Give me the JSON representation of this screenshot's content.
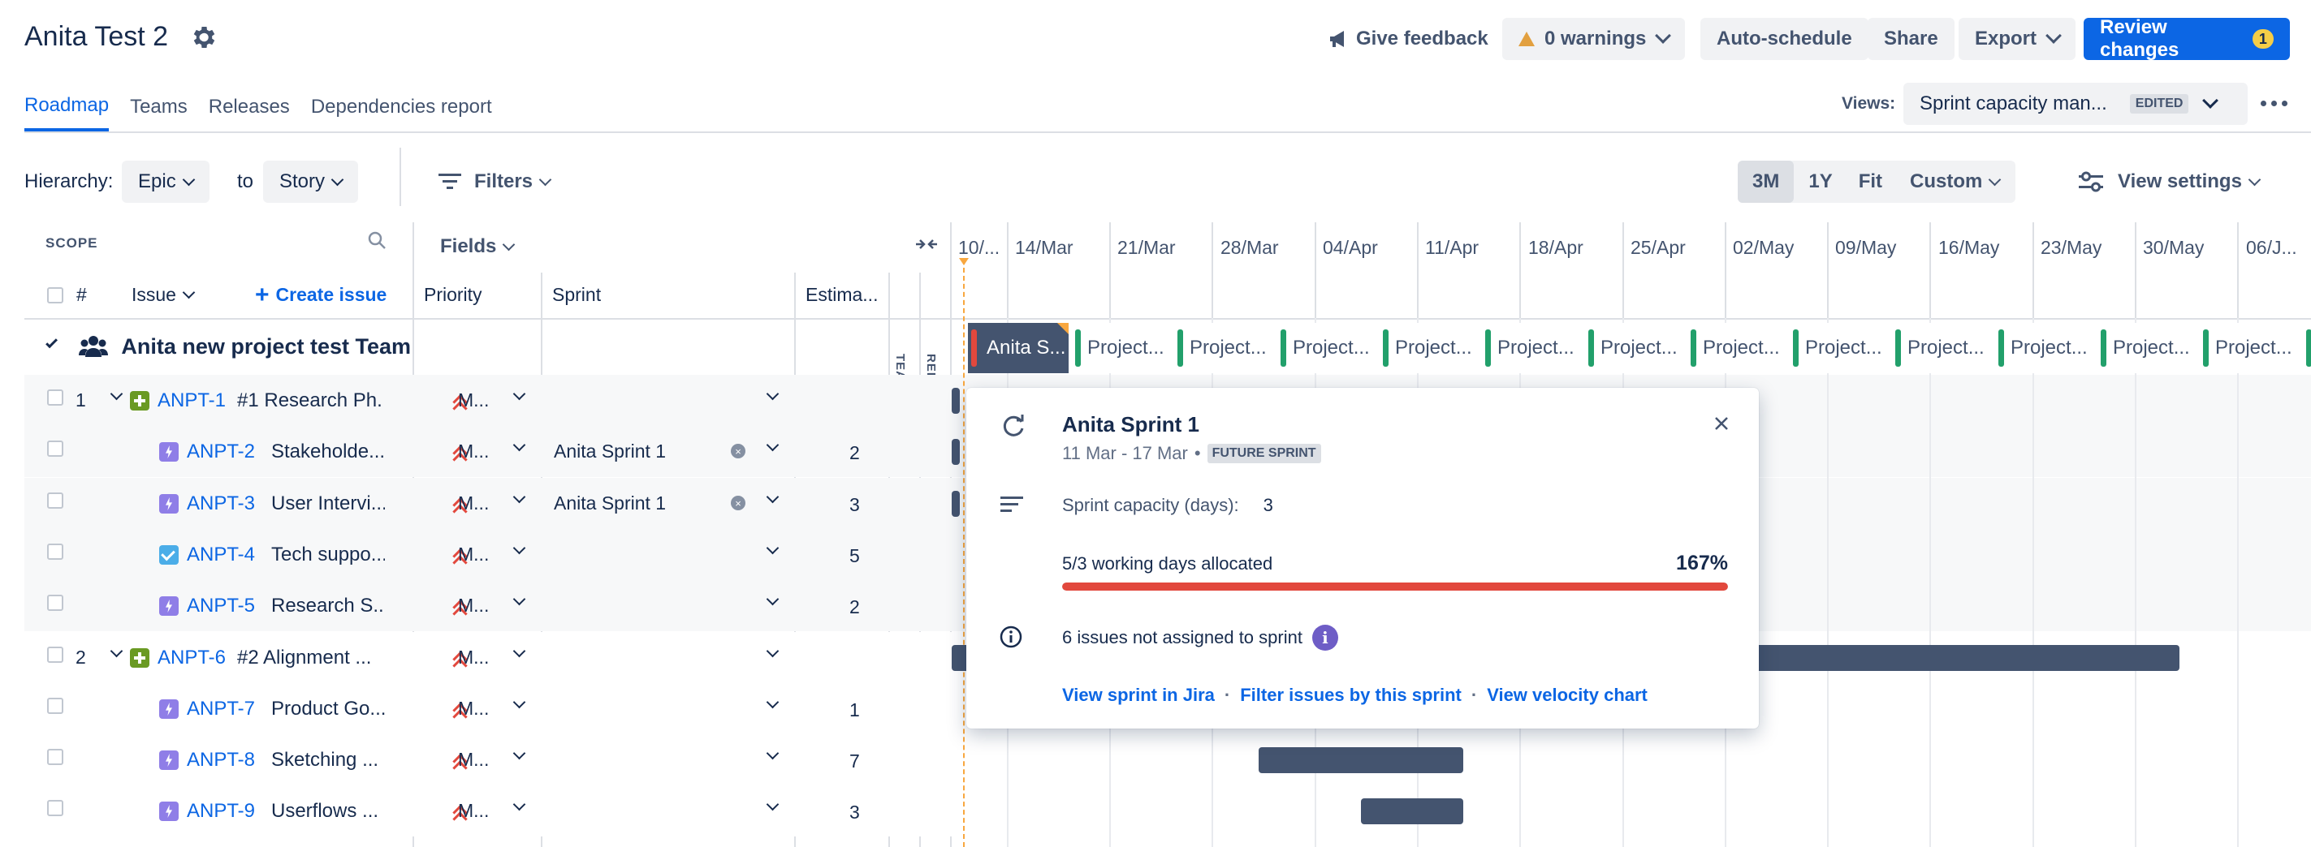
{
  "header": {
    "title": "Anita Test 2",
    "give_feedback": "Give feedback",
    "warnings": "0 warnings",
    "auto_schedule": "Auto-schedule",
    "share": "Share",
    "export": "Export",
    "review_changes": "Review changes",
    "review_count": "1"
  },
  "tabs": [
    "Roadmap",
    "Teams",
    "Releases",
    "Dependencies report"
  ],
  "views": {
    "label": "Views:",
    "value": "Sprint capacity man...",
    "badge": "EDITED"
  },
  "toolbar": {
    "hierarchy_label": "Hierarchy:",
    "hierarchy_from": "Epic",
    "to_label": "to",
    "hierarchy_to": "Story",
    "filters": "Filters",
    "zoom": [
      "3M",
      "1Y",
      "Fit",
      "Custom"
    ],
    "view_settings": "View settings"
  },
  "scope": {
    "label": "SCOPE",
    "fields": "Fields",
    "col_hash": "#",
    "col_issue": "Issue",
    "create_issue": "Create issue",
    "col_priority": "Priority",
    "col_sprint": "Sprint",
    "col_estimate": "Estima...",
    "team_vertical": "TEAM",
    "release_vertical": "RELEASE"
  },
  "group": {
    "name": "Anita new project test Team"
  },
  "rows": [
    {
      "num": "1",
      "type": "epic",
      "key": "ANPT-1",
      "summary": "#1 Research Ph...",
      "priority": "M...",
      "sprint": "",
      "estimate": ""
    },
    {
      "num": "",
      "type": "story",
      "key": "ANPT-2",
      "summary": "Stakeholde...",
      "priority": "M...",
      "sprint": "Anita Sprint 1",
      "estimate": "2"
    },
    {
      "num": "",
      "type": "story",
      "key": "ANPT-3",
      "summary": "User Intervi...",
      "priority": "M...",
      "sprint": "Anita Sprint 1",
      "estimate": "3"
    },
    {
      "num": "",
      "type": "task",
      "key": "ANPT-4",
      "summary": "Tech suppo...",
      "priority": "M...",
      "sprint": "",
      "estimate": "5"
    },
    {
      "num": "",
      "type": "story",
      "key": "ANPT-5",
      "summary": "Research S...",
      "priority": "M...",
      "sprint": "",
      "estimate": "2"
    },
    {
      "num": "2",
      "type": "epic",
      "key": "ANPT-6",
      "summary": "#2 Alignment ...",
      "priority": "M...",
      "sprint": "",
      "estimate": ""
    },
    {
      "num": "",
      "type": "story",
      "key": "ANPT-7",
      "summary": "Product Go...",
      "priority": "M...",
      "sprint": "",
      "estimate": "1"
    },
    {
      "num": "",
      "type": "story",
      "key": "ANPT-8",
      "summary": "Sketching ...",
      "priority": "M...",
      "sprint": "",
      "estimate": "7"
    },
    {
      "num": "",
      "type": "story",
      "key": "ANPT-9",
      "summary": "Userflows ...",
      "priority": "M...",
      "sprint": "",
      "estimate": "3"
    }
  ],
  "timeline": {
    "dates": [
      "10/...",
      "14/Mar",
      "21/Mar",
      "28/Mar",
      "04/Apr",
      "11/Apr",
      "18/Apr",
      "25/Apr",
      "02/May",
      "09/May",
      "16/May",
      "23/May",
      "30/May",
      "06/J..."
    ],
    "first_sprint": "Anita S...",
    "sprint_label": "Project..."
  },
  "popup": {
    "title": "Anita Sprint 1",
    "dates": "11 Mar - 17 Mar",
    "separator": "•",
    "badge": "FUTURE SPRINT",
    "capacity_label": "Sprint capacity (days):",
    "capacity_value": "3",
    "allocated_label": "5/3 working days allocated",
    "allocated_percent": "167%",
    "allocated_fraction": 1.67,
    "unassigned": "6 issues not assigned to sprint",
    "link1": "View sprint in Jira",
    "link2": "Filter issues by this sprint",
    "link3": "View velocity chart",
    "dot": "·"
  },
  "colors": {
    "accent": "#0c66e4",
    "danger": "#e2483d",
    "sprint_ok": "#22a06b",
    "bar": "#44546f"
  }
}
